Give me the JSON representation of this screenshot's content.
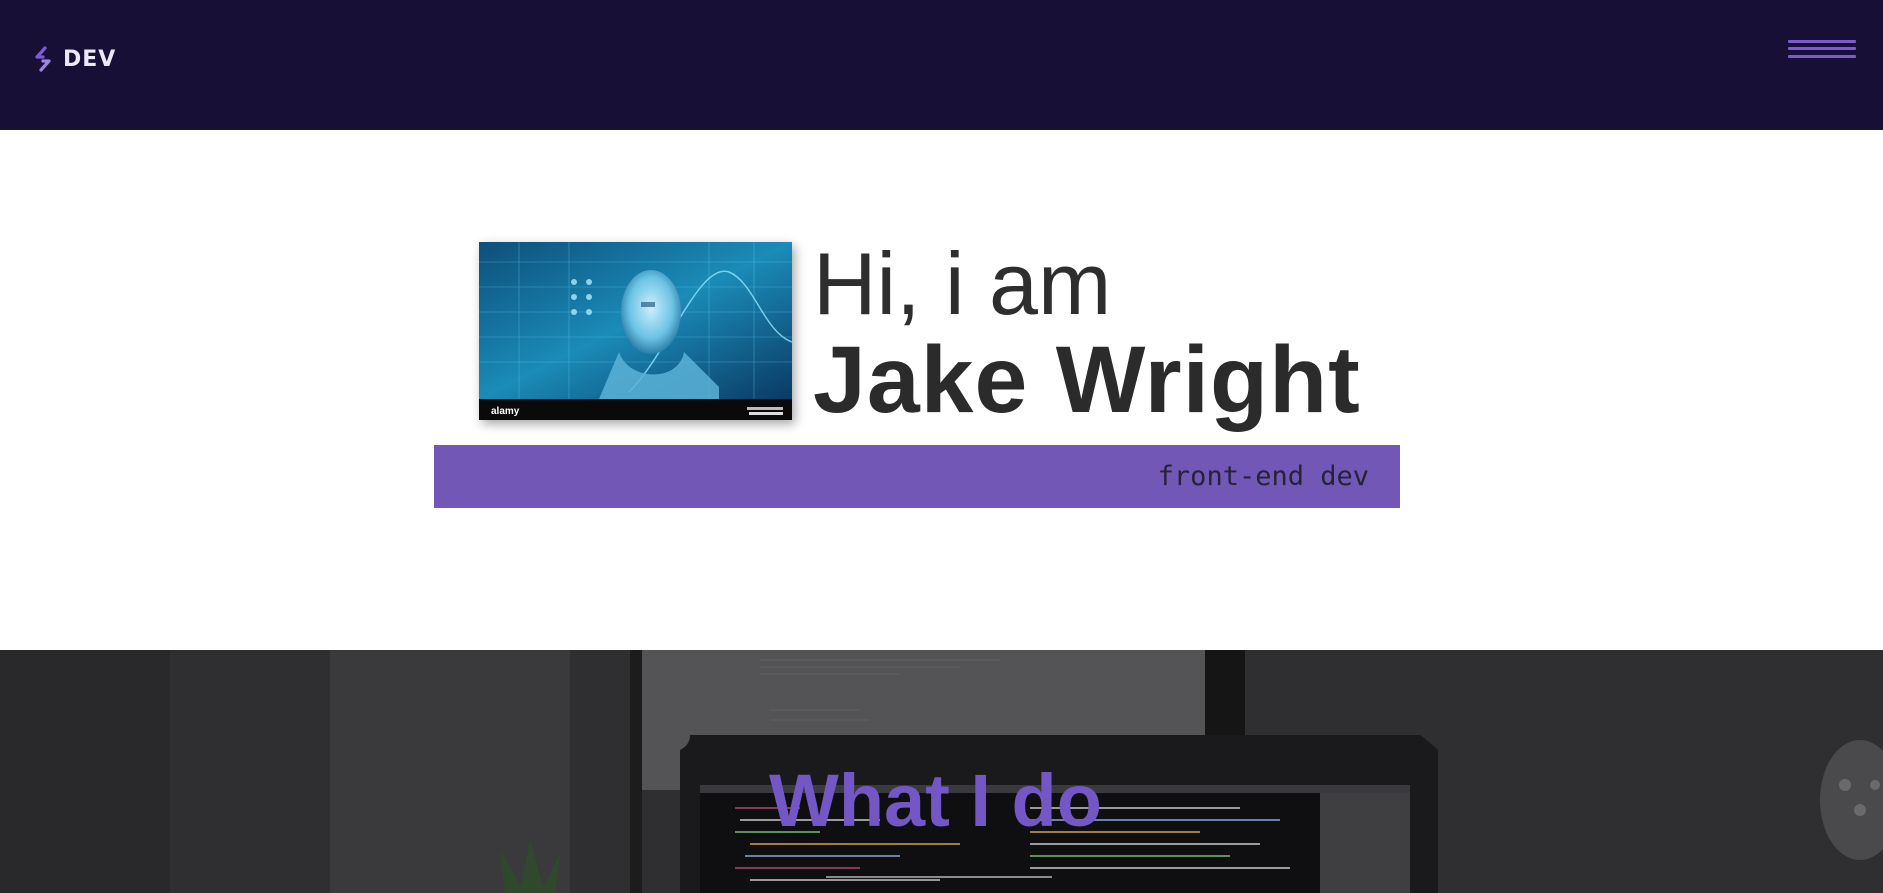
{
  "header": {
    "logo_text": "DEV",
    "logo_icon": "chevron-code-icon",
    "menu_icon": "hamburger-menu-icon",
    "background_color": "#170f36",
    "accent_color": "#7b5bd0"
  },
  "hero": {
    "photo_icon": "ai-head-photo",
    "photo_watermark": "alamy",
    "greeting": "Hi, i am",
    "name": "Jake Wright",
    "role": "front-end dev",
    "role_bar_color": "#7357b6"
  },
  "section": {
    "title": "What I do",
    "title_color": "#7357c4",
    "background": "laptop-with-code-photo"
  }
}
